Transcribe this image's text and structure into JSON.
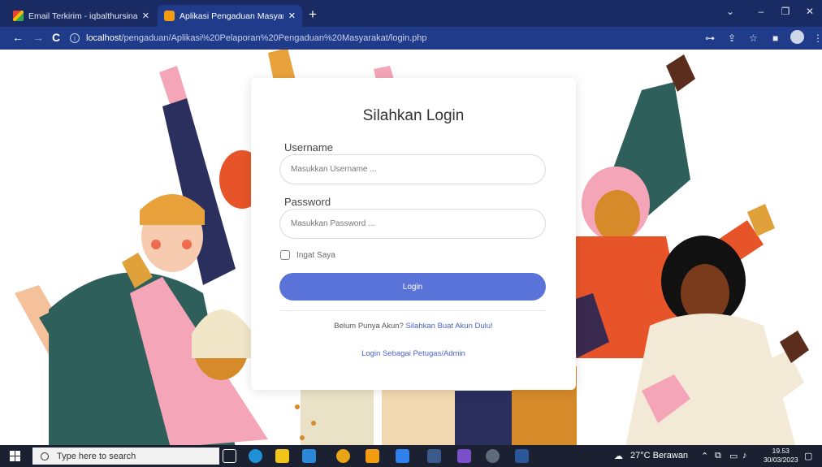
{
  "browser": {
    "tabs": [
      {
        "title": "Email Terkirim - iqbalthursina@g",
        "close": "✕"
      },
      {
        "title": "Aplikasi Pengaduan Masyarakat",
        "close": "✕"
      }
    ],
    "new_tab": "+",
    "window_controls": {
      "chevron": "⌄",
      "minimize": "–",
      "restore": "❐",
      "close": "✕"
    },
    "url_host": "localhost",
    "url_path": "/pengaduan/Aplikasi%20Pelaporan%20Pengaduan%20Masyarakat/login.php",
    "nav": {
      "back": "←",
      "forward": "→",
      "reload": "C"
    }
  },
  "login": {
    "title": "Silahkan Login",
    "username_label": "Username",
    "username_placeholder": "Masukkan Username ...",
    "password_label": "Password",
    "password_placeholder": "Masukkan Password ...",
    "remember_label": "Ingat Saya",
    "login_button": "Login",
    "signup_prompt": "Belum Punya Akun?",
    "signup_link": "Silahkan Buat Akun Dulu!",
    "admin_link": "Login Sebagai Petugas/Admin"
  },
  "taskbar": {
    "search_placeholder": "Type here to search",
    "weather": "27°C  Berawan",
    "time": "19.53",
    "date": "30/03/2023"
  },
  "colors": {
    "accent": "#5a73d8",
    "browser_frame": "#1f3b8a",
    "taskbar": "#1b2130"
  }
}
